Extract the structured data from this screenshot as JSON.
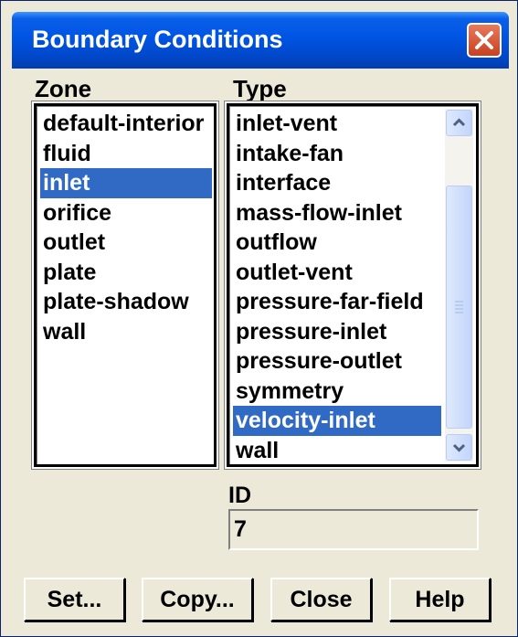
{
  "window": {
    "title": "Boundary Conditions"
  },
  "zone": {
    "label": "Zone",
    "items": [
      "default-interior",
      "fluid",
      "inlet",
      "orifice",
      "outlet",
      "plate",
      "plate-shadow",
      "wall"
    ],
    "selected": "inlet"
  },
  "type": {
    "label": "Type",
    "items": [
      "inlet-vent",
      "intake-fan",
      "interface",
      "mass-flow-inlet",
      "outflow",
      "outlet-vent",
      "pressure-far-field",
      "pressure-inlet",
      "pressure-outlet",
      "symmetry",
      "velocity-inlet",
      "wall"
    ],
    "selected": "velocity-inlet"
  },
  "id": {
    "label": "ID",
    "value": "7"
  },
  "buttons": {
    "set": "Set...",
    "copy": "Copy...",
    "close": "Close",
    "help": "Help"
  },
  "colors": {
    "title_bar": "#0054e3",
    "selection": "#316ac5",
    "dialog_bg": "#ece9d8"
  }
}
